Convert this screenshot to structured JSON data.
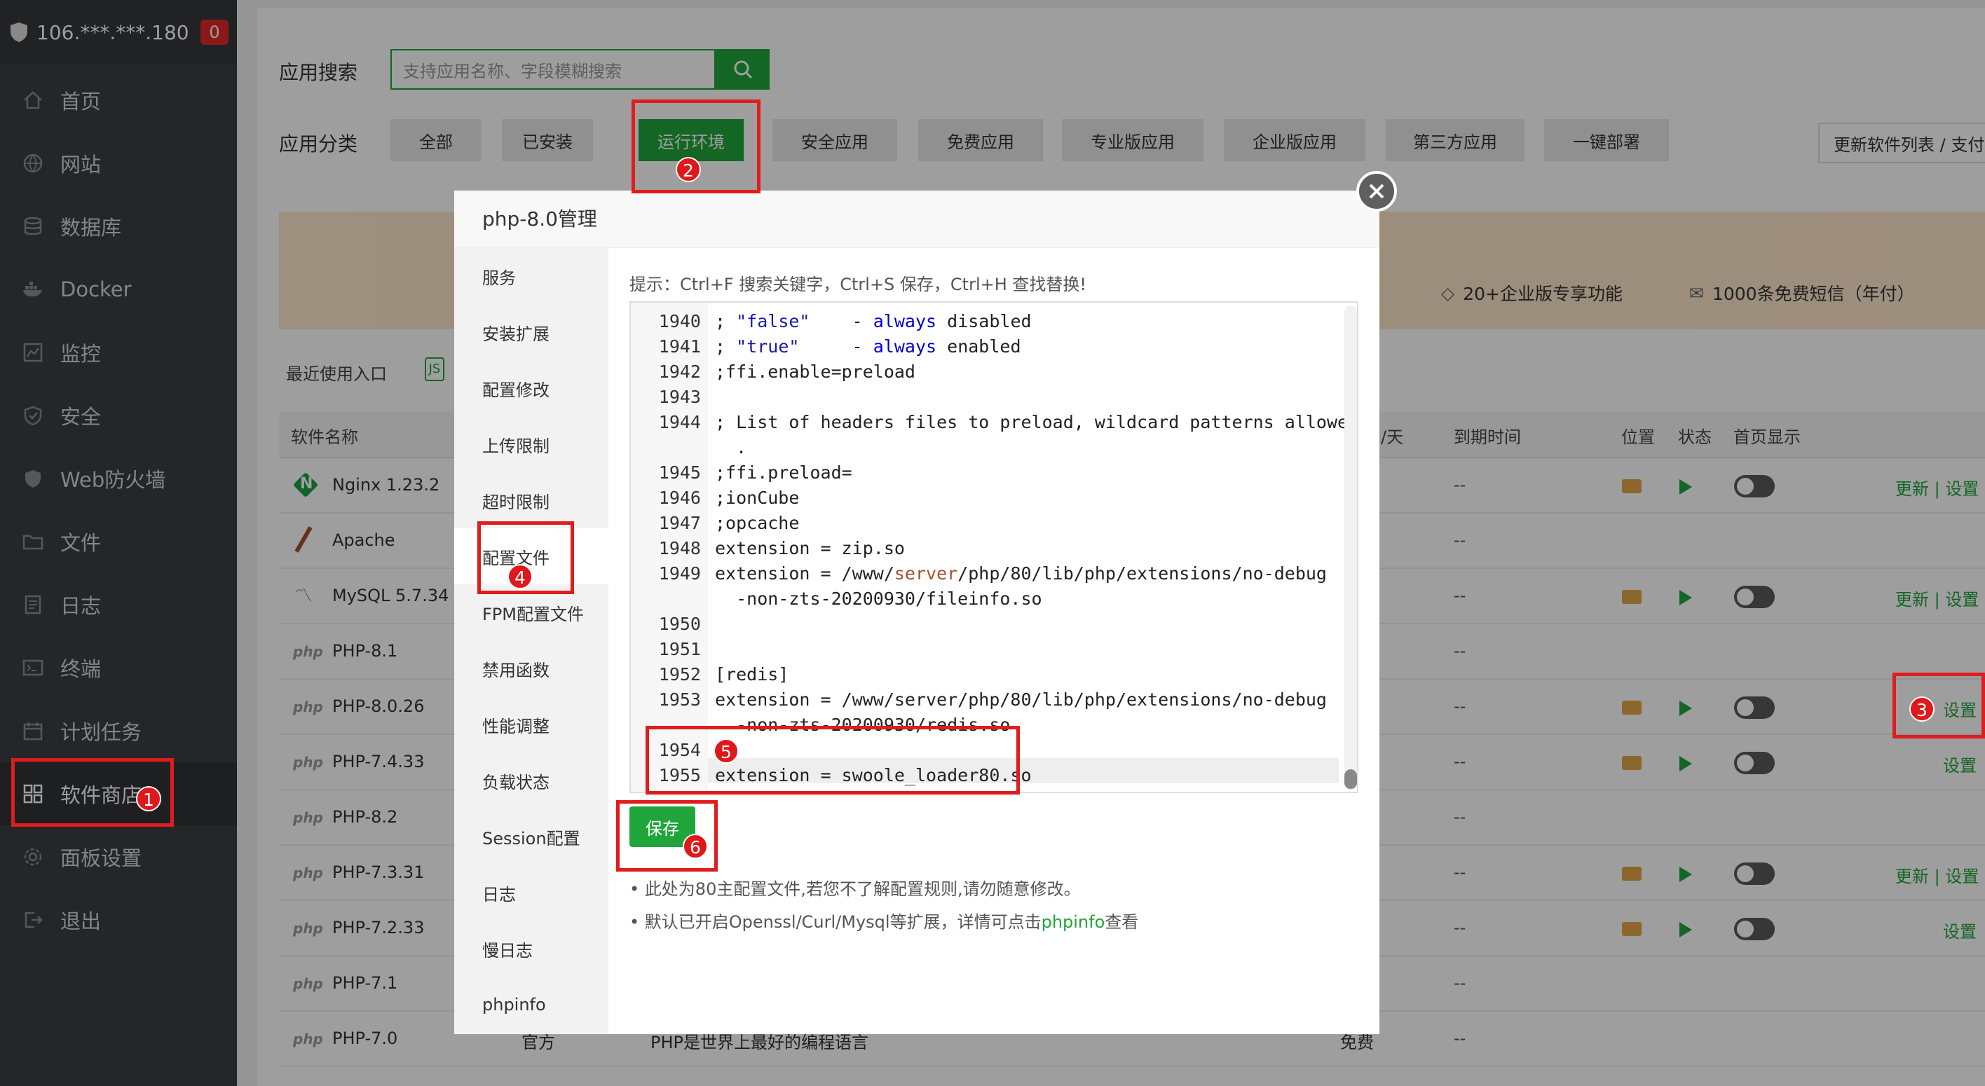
{
  "sidebar": {
    "server": "106.***.***.180",
    "badge": "0",
    "items": [
      {
        "label": "首页",
        "icon": "home-icon"
      },
      {
        "label": "网站",
        "icon": "globe-icon"
      },
      {
        "label": "数据库",
        "icon": "database-icon"
      },
      {
        "label": "Docker",
        "icon": "docker-icon"
      },
      {
        "label": "监控",
        "icon": "monitor-icon"
      },
      {
        "label": "安全",
        "icon": "shield-icon"
      },
      {
        "label": "Web防火墙",
        "icon": "firewall-icon"
      },
      {
        "label": "文件",
        "icon": "folder-icon"
      },
      {
        "label": "日志",
        "icon": "log-icon"
      },
      {
        "label": "终端",
        "icon": "terminal-icon"
      },
      {
        "label": "计划任务",
        "icon": "calendar-icon"
      },
      {
        "label": "软件商店",
        "icon": "grid-icon"
      },
      {
        "label": "面板设置",
        "icon": "gear-icon"
      },
      {
        "label": "退出",
        "icon": "logout-icon"
      }
    ]
  },
  "store": {
    "search_label": "应用搜索",
    "search_placeholder": "支持应用名称、字段模糊搜索",
    "category_label": "应用分类",
    "categories": [
      "全部",
      "已安装",
      "运行环境",
      "安全应用",
      "免费应用",
      "专业版应用",
      "企业版应用",
      "第三方应用",
      "一键部署"
    ],
    "refresh_label": "更新软件列表 / 支付",
    "banner_features": [
      "20+企业版专享功能",
      "1000条免费短信（年付）"
    ],
    "recent_label": "最近使用入口",
    "columns": {
      "name": "软件名称",
      "days": "/天",
      "expire": "到期时间",
      "location": "位置",
      "status": "状态",
      "homepage": "首页显示"
    },
    "rows": [
      {
        "name": "Nginx 1.23.2",
        "icon": "nginx-icon",
        "expire": "--",
        "links": "更新 | 设置"
      },
      {
        "name": "Apache",
        "icon": "apache-icon",
        "expire": "--",
        "links": ""
      },
      {
        "name": "MySQL 5.7.34",
        "icon": "mysql-icon",
        "expire": "--",
        "links": "更新 | 设置"
      },
      {
        "name": "PHP-8.1",
        "icon": "php",
        "expire": "--",
        "links": ""
      },
      {
        "name": "PHP-8.0.26",
        "icon": "php",
        "expire": "--",
        "links": "设置"
      },
      {
        "name": "PHP-7.4.33",
        "icon": "php",
        "expire": "--",
        "links": "设置"
      },
      {
        "name": "PHP-8.2",
        "icon": "php",
        "expire": "--",
        "links": ""
      },
      {
        "name": "PHP-7.3.31",
        "icon": "php",
        "expire": "--",
        "links": "更新 | 设置"
      },
      {
        "name": "PHP-7.2.33",
        "icon": "php",
        "expire": "--",
        "links": "设置"
      },
      {
        "name": "PHP-7.1",
        "icon": "php",
        "expire": "--",
        "links": ""
      },
      {
        "name": "PHP-7.0",
        "icon": "php",
        "expire": "--",
        "links": "",
        "type": "官方",
        "desc": "PHP是世界上最好的编程语言",
        "price": "免费"
      }
    ]
  },
  "modal": {
    "title": "php-8.0管理",
    "tabs": [
      "服务",
      "安装扩展",
      "配置修改",
      "上传限制",
      "超时限制",
      "配置文件",
      "FPM配置文件",
      "禁用函数",
      "性能调整",
      "负载状态",
      "Session配置",
      "日志",
      "慢日志",
      "phpinfo"
    ],
    "tip": "提示：Ctrl+F 搜索关键字，Ctrl+S 保存，Ctrl+H 查找替换!",
    "lines": [
      {
        "n": "1940",
        "t": "; \"false\"    - always disabled"
      },
      {
        "n": "1941",
        "t": "; \"true\"     - always enabled"
      },
      {
        "n": "1942",
        "t": ";ffi.enable=preload"
      },
      {
        "n": "1943",
        "t": ""
      },
      {
        "n": "1944",
        "t": "; List of headers files to preload, wildcard patterns allowed"
      },
      {
        "n": "",
        "t": "  ."
      },
      {
        "n": "1945",
        "t": ";ffi.preload="
      },
      {
        "n": "1946",
        "t": ";ionCube"
      },
      {
        "n": "1947",
        "t": ";opcache"
      },
      {
        "n": "1948",
        "t": "extension = zip.so"
      },
      {
        "n": "1949",
        "t": "extension = /www/server/php/80/lib/php/extensions/no-debug"
      },
      {
        "n": "",
        "t": "  -non-zts-20200930/fileinfo.so"
      },
      {
        "n": "1950",
        "t": ""
      },
      {
        "n": "1951",
        "t": ""
      },
      {
        "n": "1952",
        "t": "[redis]"
      },
      {
        "n": "1953",
        "t": "extension = /www/server/php/80/lib/php/extensions/no-debug"
      },
      {
        "n": "",
        "t": "  -non-zts-20200930/redis.so"
      },
      {
        "n": "1954",
        "t": ""
      },
      {
        "n": "1955",
        "t": "extension = swoole_loader80.so"
      }
    ],
    "save_label": "保存",
    "notes": [
      {
        "text": "此处为80主配置文件,若您不了解配置规则,请勿随意修改。",
        "link": ""
      },
      {
        "text": "默认已开启Openssl/Curl/Mysql等扩展，详情可点击",
        "link": "phpinfo",
        "tail": "查看"
      }
    ]
  },
  "badges": [
    "1",
    "2",
    "3",
    "4",
    "5",
    "6"
  ],
  "colors": {
    "accent": "#20a53a",
    "highlight": "#e01d1d",
    "sidebar": "#3b3e42"
  }
}
